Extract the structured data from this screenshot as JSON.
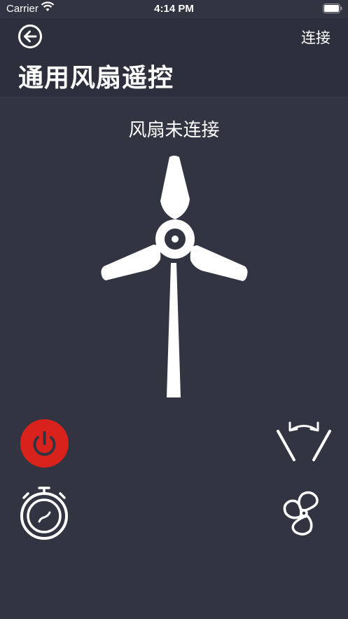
{
  "statusbar": {
    "carrier": "Carrier",
    "time": "4:14 PM"
  },
  "header": {
    "title": "通用风扇遥控",
    "connect_label": "连接"
  },
  "device": {
    "status": "风扇未连接"
  },
  "icons": {
    "back": "back-arrow-icon",
    "fan": "wind-turbine-icon",
    "power": "power-icon",
    "timer": "stopwatch-icon",
    "swing": "swing-oscillation-icon",
    "mode": "fan-mode-icon"
  },
  "colors": {
    "background": "#323442",
    "power_active": "#d9221b",
    "foreground": "#ffffff"
  }
}
